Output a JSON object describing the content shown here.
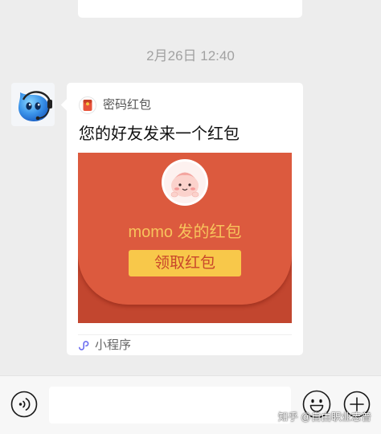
{
  "timestamp": "2月26日 12:40",
  "colors": {
    "chat_background": "#ededed",
    "envelope_top": "#dc5a3e",
    "envelope_bottom": "#c2462f",
    "envelope_text": "#f7c35c",
    "button_fill": "#f8c84a",
    "button_text": "#c9462b",
    "mini_program_icon": "#6a6cf0"
  },
  "message": {
    "avatar_icon": "blue-mascot-headset-icon",
    "card": {
      "brand_icon": "red-envelope-icon",
      "brand_label": "密码红包",
      "title": "您的好友发来一个红包",
      "envelope": {
        "sender_avatar_icon": "pink-character-avatar",
        "sender_text": "momo 发的红包",
        "button_label": "领取红包"
      },
      "footer_icon": "mini-program-icon",
      "footer_label": "小程序"
    }
  },
  "input_bar": {
    "voice_icon": "voice-icon",
    "input_value": "",
    "emoji_icon": "emoji-icon",
    "more_icon": "plus-icon"
  },
  "watermark": "知乎 @自由职业志普"
}
